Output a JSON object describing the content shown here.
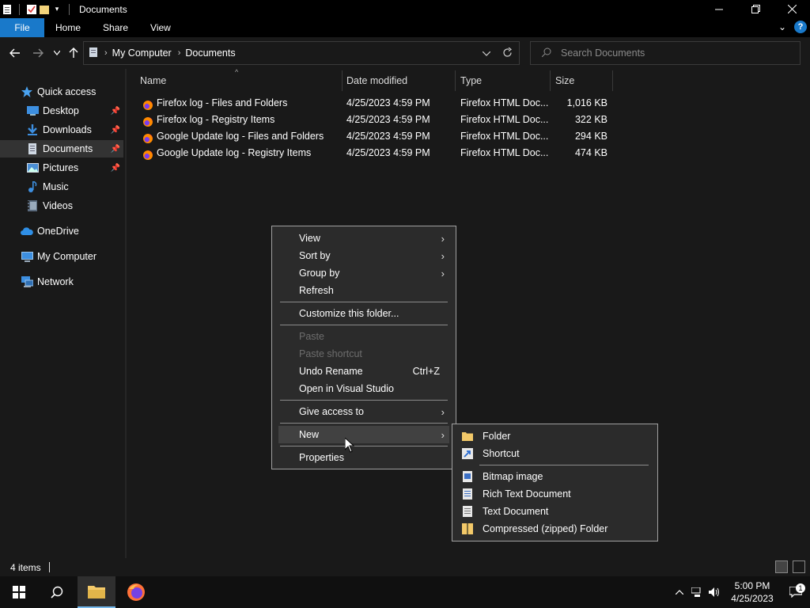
{
  "window": {
    "title": "Documents",
    "minimize_icon": "minimize-icon",
    "maximize_icon": "restore-icon",
    "close_icon": "close-icon"
  },
  "ribbon": {
    "tabs": [
      "File",
      "Home",
      "Share",
      "View"
    ],
    "accent": "#1979ca",
    "help_label": "?"
  },
  "address": {
    "crumbs": [
      "My Computer",
      "Documents"
    ],
    "search_placeholder": "Search Documents"
  },
  "nav_pane": {
    "items": [
      {
        "label": "Quick access",
        "icon": "star-icon"
      },
      {
        "label": "Desktop",
        "icon": "desktop-icon",
        "pinned": true
      },
      {
        "label": "Downloads",
        "icon": "download-icon",
        "pinned": true
      },
      {
        "label": "Documents",
        "icon": "document-icon",
        "pinned": true,
        "selected": true
      },
      {
        "label": "Pictures",
        "icon": "pictures-icon",
        "pinned": true
      },
      {
        "label": "Music",
        "icon": "music-icon"
      },
      {
        "label": "Videos",
        "icon": "videos-icon"
      },
      {
        "label": "OneDrive",
        "icon": "cloud-icon"
      },
      {
        "label": "My Computer",
        "icon": "computer-icon"
      },
      {
        "label": "Network",
        "icon": "network-icon"
      }
    ]
  },
  "file_list": {
    "columns": [
      "Name",
      "Date modified",
      "Type",
      "Size"
    ],
    "rows": [
      {
        "name": "Firefox log - Files and Folders",
        "date": "4/25/2023 4:59 PM",
        "type": "Firefox HTML Doc...",
        "size": "1,016 KB"
      },
      {
        "name": "Firefox log - Registry Items",
        "date": "4/25/2023 4:59 PM",
        "type": "Firefox HTML Doc...",
        "size": "322 KB"
      },
      {
        "name": "Google Update log - Files and Folders",
        "date": "4/25/2023 4:59 PM",
        "type": "Firefox HTML Doc...",
        "size": "294 KB"
      },
      {
        "name": "Google Update log - Registry Items",
        "date": "4/25/2023 4:59 PM",
        "type": "Firefox HTML Doc...",
        "size": "474 KB"
      }
    ]
  },
  "context_menu": {
    "view": "View",
    "sort_by": "Sort by",
    "group_by": "Group by",
    "refresh": "Refresh",
    "customize": "Customize this folder...",
    "paste": "Paste",
    "paste_shortcut": "Paste shortcut",
    "undo_rename": "Undo Rename",
    "undo_shortcut": "Ctrl+Z",
    "open_vs": "Open in Visual Studio",
    "give_access": "Give access to",
    "new": "New",
    "properties": "Properties"
  },
  "new_submenu": {
    "folder": "Folder",
    "shortcut": "Shortcut",
    "bitmap": "Bitmap image",
    "rtf": "Rich Text Document",
    "text": "Text Document",
    "zip": "Compressed (zipped) Folder"
  },
  "status_bar": {
    "count": "4 items"
  },
  "taskbar": {
    "time": "5:00 PM",
    "date": "4/25/2023",
    "notification_count": "1"
  }
}
